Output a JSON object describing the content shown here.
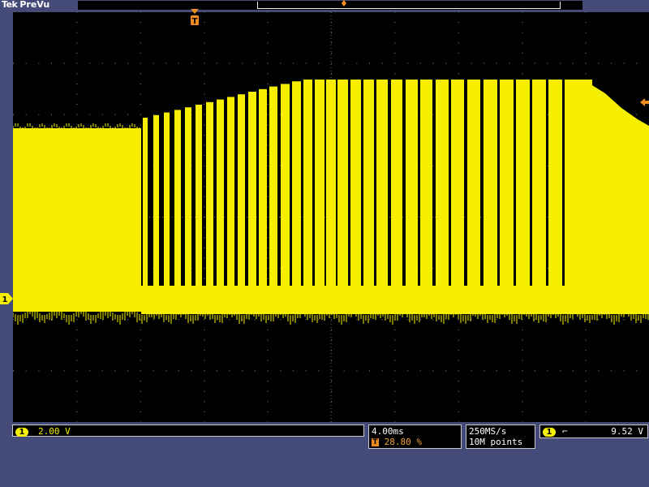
{
  "header": {
    "brand": "Tek",
    "mode": "PreVu"
  },
  "colors": {
    "trace": "#f6f000",
    "accent": "#f08c1e",
    "background": "#454b78",
    "screen": "#000000",
    "grid": "#8a8a8a"
  },
  "icons": {
    "trigger_position": "trigger-T-marker-icon",
    "channel_marker": "ch1-ground-marker-icon",
    "trigger_level": "trigger-level-arrow-icon",
    "slope": "falling-edge-icon"
  },
  "markers": {
    "ch1": "1",
    "trigger": "T"
  },
  "readouts": {
    "ch1": {
      "channel": "1",
      "scale": "2.00 V"
    },
    "time": {
      "scale": "4.00ms",
      "delay": "28.80 %"
    },
    "acq": {
      "rate": "250MS/s",
      "length": "10M points"
    },
    "trigger": {
      "source": "1",
      "slope": "⌐",
      "level": "9.52 V"
    }
  }
}
